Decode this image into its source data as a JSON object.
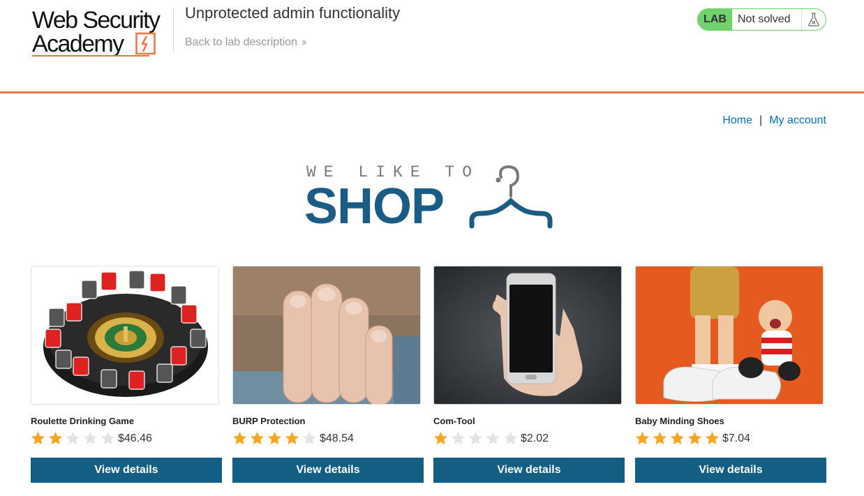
{
  "header": {
    "logo": {
      "line1": "Web Security",
      "line2": "Academy"
    },
    "lab_title": "Unprotected admin functionality",
    "back_link": "Back to lab description",
    "lab_badge": "LAB",
    "lab_status": "Not solved",
    "colors": {
      "accent": "#ee7444",
      "status_green": "#70d16d"
    }
  },
  "nav": {
    "home": "Home",
    "separator": "|",
    "account": "My account"
  },
  "banner": {
    "small": "WE LIKE TO",
    "big": "SHOP"
  },
  "products": [
    {
      "name": "Roulette Drinking Game",
      "rating": 2,
      "price": "$46.46",
      "button": "View details",
      "image": "roulette-drinking-game-image"
    },
    {
      "name": "BURP Protection",
      "rating": 4,
      "price": "$48.54",
      "button": "View details",
      "image": "burp-protection-image"
    },
    {
      "name": "Com-Tool",
      "rating": 1,
      "price": "$2.02",
      "button": "View details",
      "image": "com-tool-phone-image"
    },
    {
      "name": "Baby Minding Shoes",
      "rating": 5,
      "price": "$7.04",
      "button": "View details",
      "image": "baby-minding-shoes-image"
    }
  ],
  "colors": {
    "button": "#135f84",
    "star_on": "#f5a623",
    "star_off": "#e3e3e3",
    "link": "#0071bc"
  }
}
